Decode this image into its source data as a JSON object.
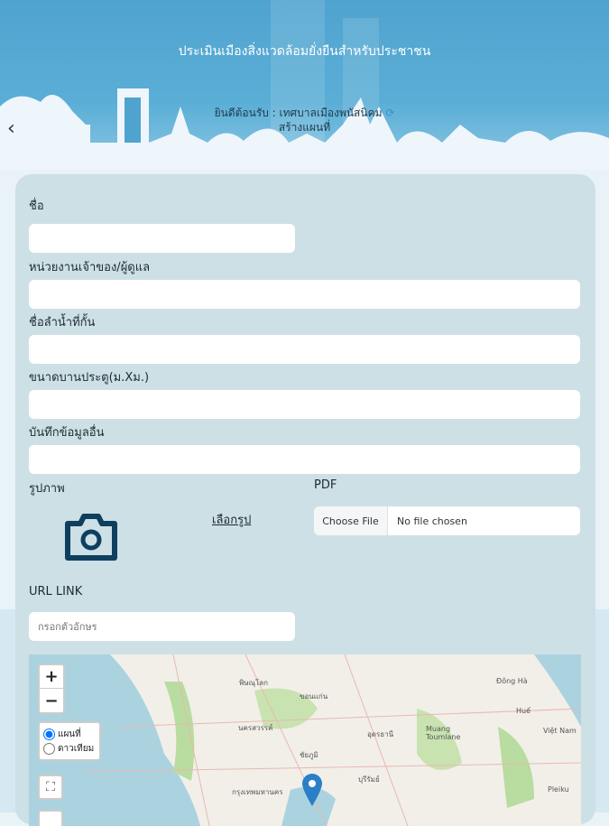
{
  "header": {
    "title": "ประเมินเมืองสิ่งแวดล้อมยั่งยืนสำหรับประชาชน",
    "welcome": "ยินดีต้อนรับ : เทศบาลเมืองพนัสนิคม",
    "subtitle": "สร้างแผนที่",
    "back_icon": "chevron-left-icon"
  },
  "form": {
    "name_label": "ชื่อ",
    "owner_label": "หน่วยงานเจ้าของ/ผู้ดูแล",
    "river_label": "ชื่อลำน้ำที่กั้น",
    "gate_size_label": "ขนาดบานประตู(ม.Xม.)",
    "notes_label": "บันทึกข้อมูลอื่น",
    "image_label": "รูปภาพ",
    "choose_image": "เลือกรูป",
    "pdf_label": "PDF",
    "choose_file": "Choose File",
    "no_file": "No file chosen",
    "url_label": "URL LINK",
    "url_placeholder": "กรอกตัวอักษร"
  },
  "map": {
    "zoom_in": "+",
    "zoom_out": "−",
    "layer_map": "แผนที่",
    "layer_satellite": "ดาวเทียม",
    "selected_layer": "แผนที่",
    "places": [
      "พิษณุโลก",
      "นครสวรรค์",
      "กรุงเทพมหานคร",
      "อุดรธานี",
      "ขอนแก่น",
      "Đông Hà",
      "Huế",
      "Muang Toumlane",
      "Việt Nam",
      "Pleiku",
      "ชัยภูมิ",
      "บุรีรัมย์"
    ]
  },
  "colors": {
    "header": "#4fa3cf",
    "card": "#cde0e6",
    "icon": "#0f3f5f",
    "marker": "#2a7fc7"
  }
}
